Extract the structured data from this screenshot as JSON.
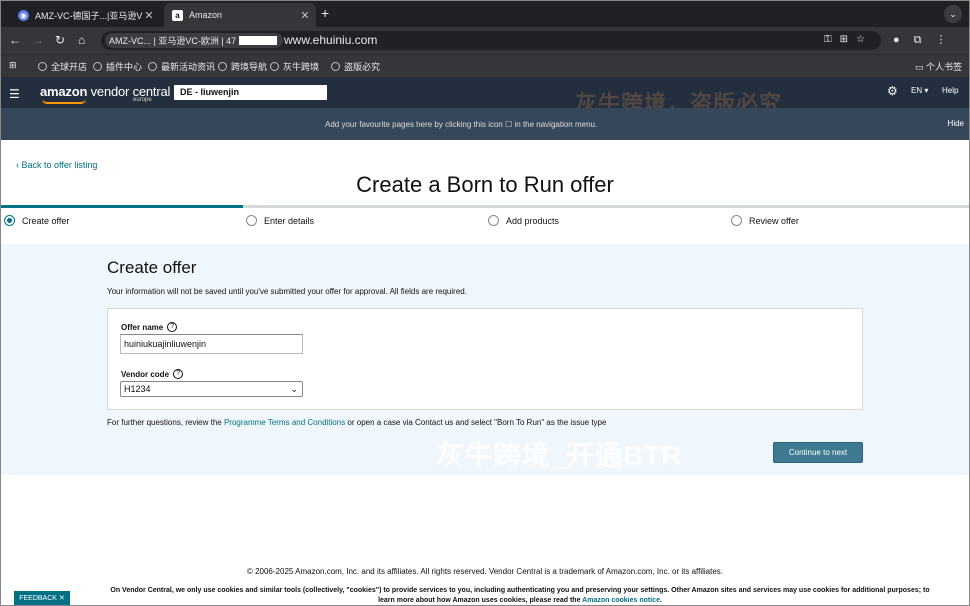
{
  "browser": {
    "tabs": [
      {
        "title": "AMZ-VC-德国子...|亚马逊VC-欧",
        "active": false
      },
      {
        "title": "Amazon",
        "active": true
      }
    ],
    "new_tab": "+",
    "omnibox_tab": "AMZ-VC... | 亚马逊VC-欧洲 | 47",
    "watermark_url": "www.ehuiniu.com",
    "bookmarks": [
      "全球开店",
      "插件中心",
      "最新活动资讯",
      "跨境导航",
      "灰牛跨境",
      "盗版必究"
    ],
    "bookmarks_right": "个人书签"
  },
  "vc": {
    "logo_main": "amazon",
    "logo_rest": " vendor central",
    "logo_sub": "europe",
    "account": "DE - liuwenjin",
    "lang": "EN",
    "help": "Help",
    "watermark_top": "灰牛跨境，盗版必究",
    "fav_message": "Add your favourite pages here by clicking this icon ☐ in the navigation menu.",
    "hide": "Hide"
  },
  "page": {
    "back_link": "Back to offer listing",
    "title": "Create a Born to Run offer",
    "steps": [
      {
        "label": "Create offer",
        "active": true
      },
      {
        "label": "Enter details",
        "active": false
      },
      {
        "label": "Add products",
        "active": false
      },
      {
        "label": "Review offer",
        "active": false
      }
    ],
    "progress": 0.25,
    "section_title": "Create offer",
    "section_desc": "Your information will not be saved until you've submitted your offer for approval. All fields are required.",
    "offer_name_label": "Offer name",
    "offer_name_value": "huiniukuajinliuwenjin",
    "vendor_code_label": "Vendor code",
    "vendor_code_value": "H1234",
    "terms_prefix": "For further questions, review the ",
    "terms_link": "Programme Terms and Conditions",
    "terms_suffix": " or open a case via Contact us and select \"Born To Run\" as the issue type",
    "continue_button": "Continue to next",
    "watermark_mid": "灰牛跨境_开通BTR"
  },
  "footer": {
    "copyright": "© 2006-2025 Amazon.com, Inc. and its affiliates. All rights reserved. Vendor Central is a trademark of Amazon.com, Inc. or its affiliates.",
    "cookie_line1": "On Vendor Central, we only use cookies and similar tools (collectively, \"cookies\") to provide services to you, including authenticating you and preserving your settings. Other Amazon sites and services may use cookies for additional purposes; to",
    "cookie_line2_prefix": "learn more about how Amazon uses cookies, please read the ",
    "cookie_link": "Amazon cookies notice",
    "cookie_line2_suffix": ".",
    "feedback": "FEEDBACK ✕"
  }
}
